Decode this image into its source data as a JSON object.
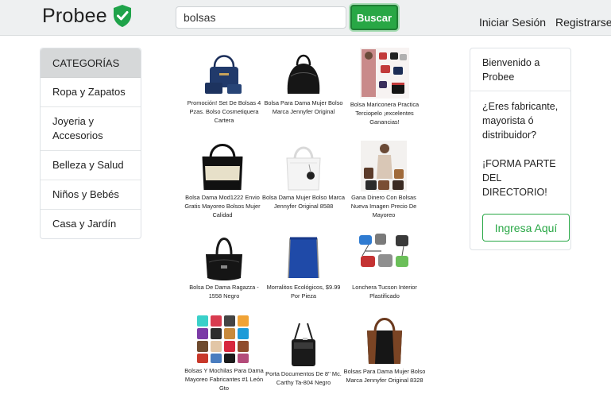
{
  "header": {
    "logo_text": "Probee",
    "search_value": "bolsas",
    "search_button": "Buscar",
    "login_link": "Iniciar Sesión",
    "register_link": "Registrarse"
  },
  "sidebar": {
    "title": "CATEGORÍAS",
    "items": [
      {
        "label": "Ropa y Zapatos"
      },
      {
        "label": "Joyeria y Accesorios"
      },
      {
        "label": "Belleza y Salud"
      },
      {
        "label": "Niños y Bebés"
      },
      {
        "label": "Casa y Jardín"
      }
    ]
  },
  "products": [
    {
      "name": "Promoción! Set De Bolsas 4 Pzas. Bolso Cosmetiquera Cartera",
      "icon": "navy-handbag-set-image"
    },
    {
      "name": "Bolsa Para Dama Mujer Bolso Marca Jennyfer Original",
      "icon": "black-dome-handbag-image"
    },
    {
      "name": "Bolsa Mariconera Practica Terciopelo ¡excelentes Ganancias!",
      "icon": "handbag-collection-image"
    },
    {
      "name": "Bolsa Dama Mod1222 Envio Gratis Mayoreo Bolsos Mujer Calidad",
      "icon": "beige-black-tote-image"
    },
    {
      "name": "Bolsa Dama Mujer Bolso Marca Jennyfer Original 8588",
      "icon": "white-tote-image"
    },
    {
      "name": "Gana Dinero Con Bolsas Nueva Imagen Precio De Mayoreo",
      "icon": "model-with-bags-image"
    },
    {
      "name": "Bolsa De Dama Ragazza - 1558 Negro",
      "icon": "black-shoulder-bag-image"
    },
    {
      "name": "Morralitos Ecológicos, $9.99 Por Pieza",
      "icon": "blue-drawstring-bag-image"
    },
    {
      "name": "Lonchera Tucson Interior Plastificado",
      "icon": "lunch-bags-image"
    },
    {
      "name": "Bolsas Y Mochilas Para Dama Mayoreo Fabricantes #1 León Gto",
      "icon": "bags-grid-image"
    },
    {
      "name": "Porta Documentos De 8'' Mc. Carthy Ta-804 Negro",
      "icon": "document-holder-image"
    },
    {
      "name": "Bolsas Para Dama Mujer Bolso Marca Jennyfer Original 8328",
      "icon": "brown-black-tote-image"
    }
  ],
  "welcome_card": {
    "greeting": "Bienvenido a Probee",
    "question": "¿Eres fabricante, mayorista ó distribuidor?",
    "call": "¡FORMA PARTE DEL DIRECTORIO!",
    "button": "Ingresa Aquí"
  },
  "colors": {
    "accent": "#28a745",
    "header_bg": "#eef0f1",
    "category_header_bg": "#d6d8d9"
  }
}
